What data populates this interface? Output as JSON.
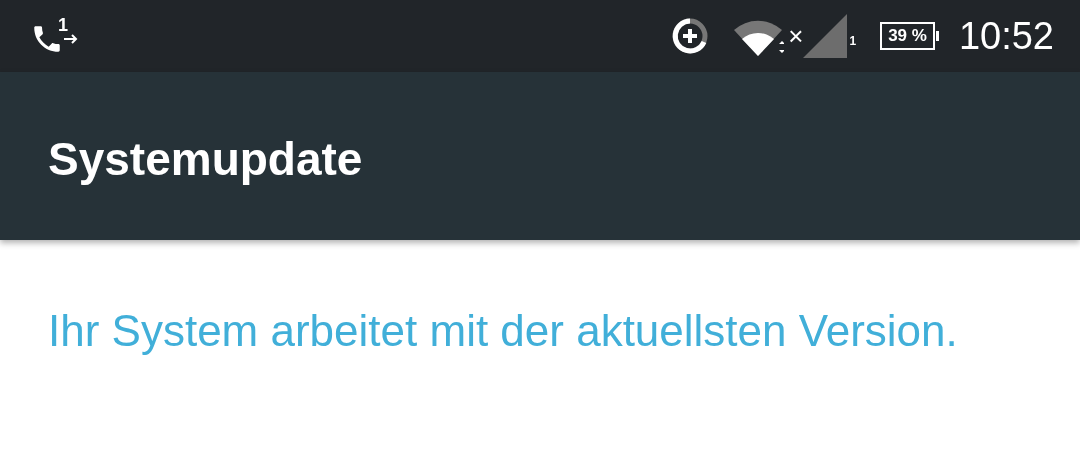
{
  "status_bar": {
    "call_sim": "1",
    "data_off": "×",
    "signal_sim": "1",
    "battery": "39 %",
    "time": "10:52"
  },
  "toolbar": {
    "title": "Systemupdate"
  },
  "message": "Ihr System arbeitet mit der aktuellsten Version."
}
